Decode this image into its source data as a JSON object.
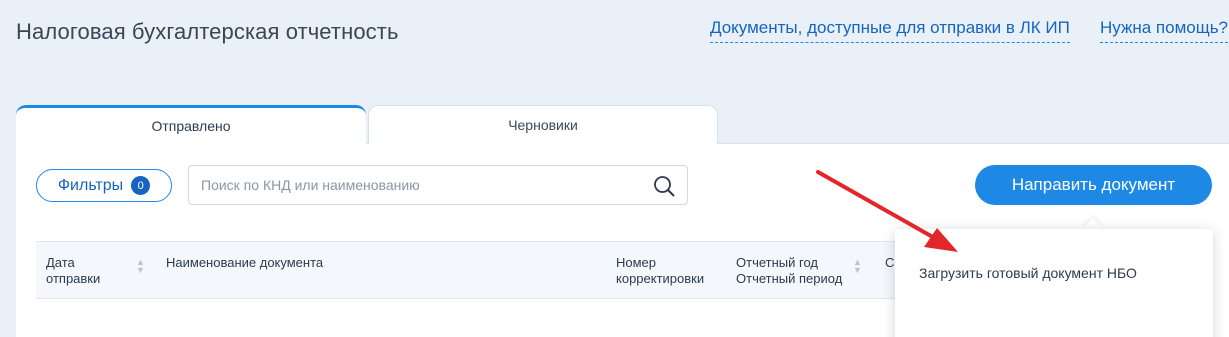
{
  "header": {
    "title": "Налоговая бухгалтерская отчетность",
    "docs_link": "Документы, доступные для отправки в ЛК ИП",
    "help_link": "Нужна помощь?"
  },
  "tabs": [
    {
      "label": "Отправлено",
      "active": true
    },
    {
      "label": "Черновики",
      "active": false
    }
  ],
  "toolbar": {
    "filters_label": "Фильтры",
    "filters_count": "0",
    "search_placeholder": "Поиск по КНД или наименованию",
    "search_value": "",
    "send_button": "Направить документ"
  },
  "table": {
    "columns": [
      {
        "line1": "Дата",
        "line2": "отправки"
      },
      {
        "line1": "Наименование документа",
        "line2": ""
      },
      {
        "line1": "Номер",
        "line2": "корректировки"
      },
      {
        "line1": "Отчетный год",
        "line2": "Отчетный период"
      },
      {
        "line1": "С",
        "line2": ""
      }
    ]
  },
  "dropdown": {
    "items": [
      "Загрузить готовый документ НБО"
    ]
  },
  "colors": {
    "accent": "#1e88e5",
    "link": "#1565c0",
    "background": "#eaf0f8",
    "annotation_arrow": "#e3262a"
  },
  "icons": {
    "search": "search-icon",
    "sort": "sort-icon",
    "annotation": "red-arrow-icon"
  }
}
